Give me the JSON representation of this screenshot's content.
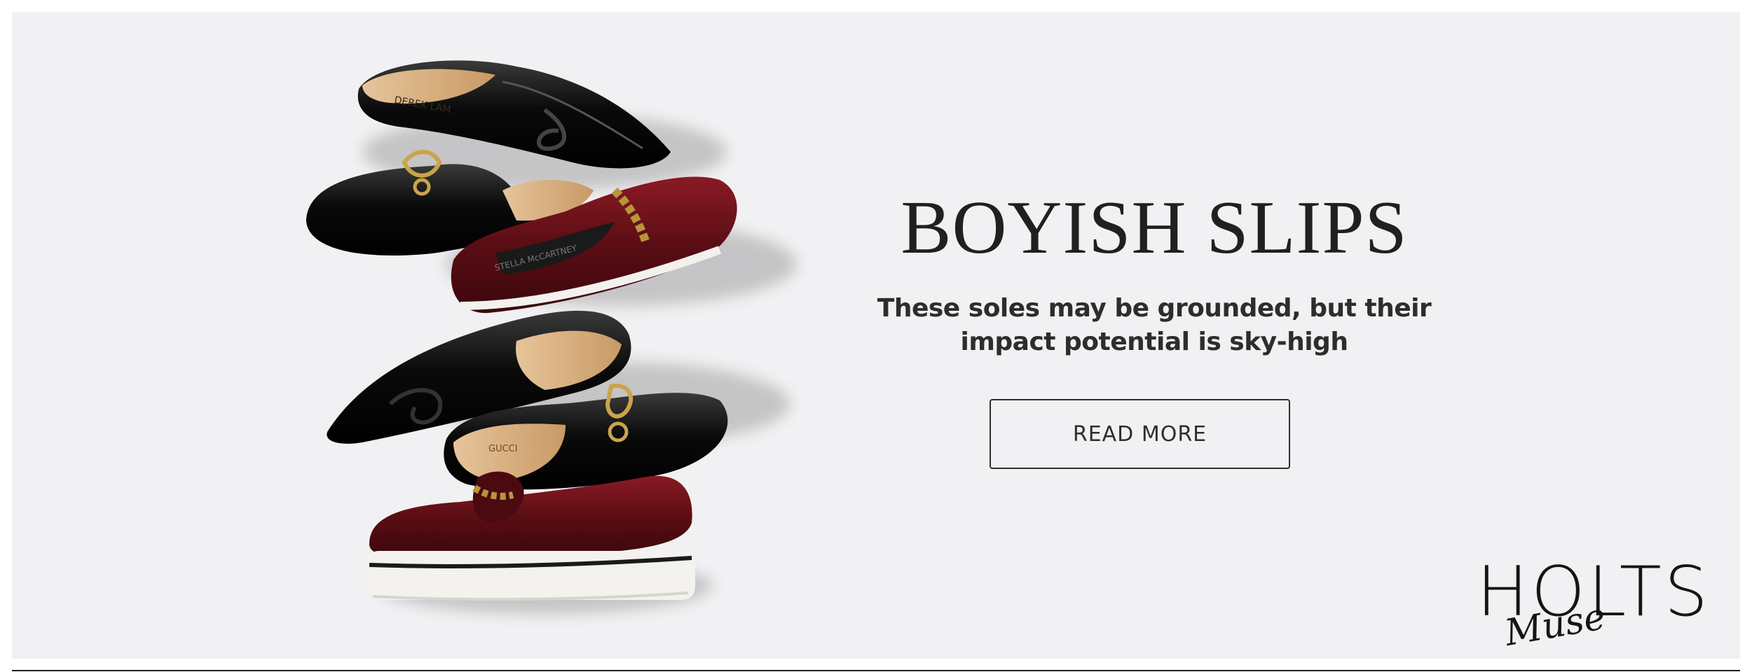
{
  "banner": {
    "headline": "BOYISH SLIPS",
    "subheadline_line1": "These soles may be grounded, but their",
    "subheadline_line2": "impact potential is sky-high",
    "cta_label": "READ MORE"
  },
  "brand": {
    "logo_main": "HOLTS",
    "logo_script": "Muse"
  },
  "shoes": {
    "brand_marks": [
      "DEREK LAM",
      "GUCCI",
      "STELLA McCARTNEY"
    ]
  },
  "colors": {
    "background": "#f1f0f2",
    "text_dark": "#202020",
    "burgundy": "#6b1119",
    "patent_black": "#0b0b0b"
  }
}
